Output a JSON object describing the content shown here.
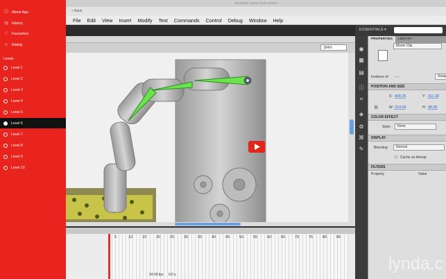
{
  "sidebar": {
    "top_items": [
      {
        "icon": "info-icon",
        "label": "About App"
      },
      {
        "icon": "history-icon",
        "label": "History"
      },
      {
        "icon": "heart-icon",
        "label": "Favourites"
      },
      {
        "icon": "star-icon",
        "label": "Rating"
      }
    ],
    "levels_heading": "Levels",
    "levels": [
      "Level 1",
      "Level 2",
      "Level 3",
      "Level 4",
      "Level 5",
      "Level 6",
      "Level 7",
      "Level 8",
      "Level 9",
      "Level 10"
    ],
    "active_level": "Level 6"
  },
  "window": {
    "title": "Simplified Adobe Flash Edition",
    "back_label": "< Back"
  },
  "menu": [
    "File",
    "Edit",
    "View",
    "Insert",
    "Modify",
    "Text",
    "Commands",
    "Control",
    "Debug",
    "Window",
    "Help"
  ],
  "workspace": {
    "label": "ESSENTIALS ▾"
  },
  "stage": {
    "zoom": "184%"
  },
  "properties": {
    "tabs": [
      "PROPERTIES",
      "LIBRARY"
    ],
    "symbol_type": "Movie Clip",
    "instance_of_label": "Instance of:",
    "instance_of_value": "----",
    "swap_label": "Swap",
    "position_size_title": "POSITION AND SIZE",
    "x_label": "X:",
    "x_value": "408.25",
    "y_label": "Y:",
    "y_value": "311.30",
    "w_label": "W:",
    "w_value": "214.65",
    "h_label": "H:",
    "h_value": "98.05",
    "color_effect_title": "COLOR EFFECT",
    "style_label": "Style:",
    "style_value": "None",
    "display_title": "DISPLAY",
    "blending_label": "Blending:",
    "blending_value": "Normal",
    "cache_label": "Cache as bitmap",
    "filters_title": "FILTERS",
    "filters_cols": [
      "Property",
      "Value"
    ]
  },
  "timeline": {
    "tabs": [
      "MOTION EDITOR",
      "OUTPUT"
    ],
    "frame_numbers": [
      "5",
      "10",
      "15",
      "20",
      "25",
      "30",
      "35",
      "40",
      "45",
      "50",
      "55",
      "60",
      "65",
      "70",
      "75",
      "80",
      "85"
    ],
    "fps": "24.00 fps",
    "time": "0.0 s"
  },
  "watermark": "lynda.c"
}
